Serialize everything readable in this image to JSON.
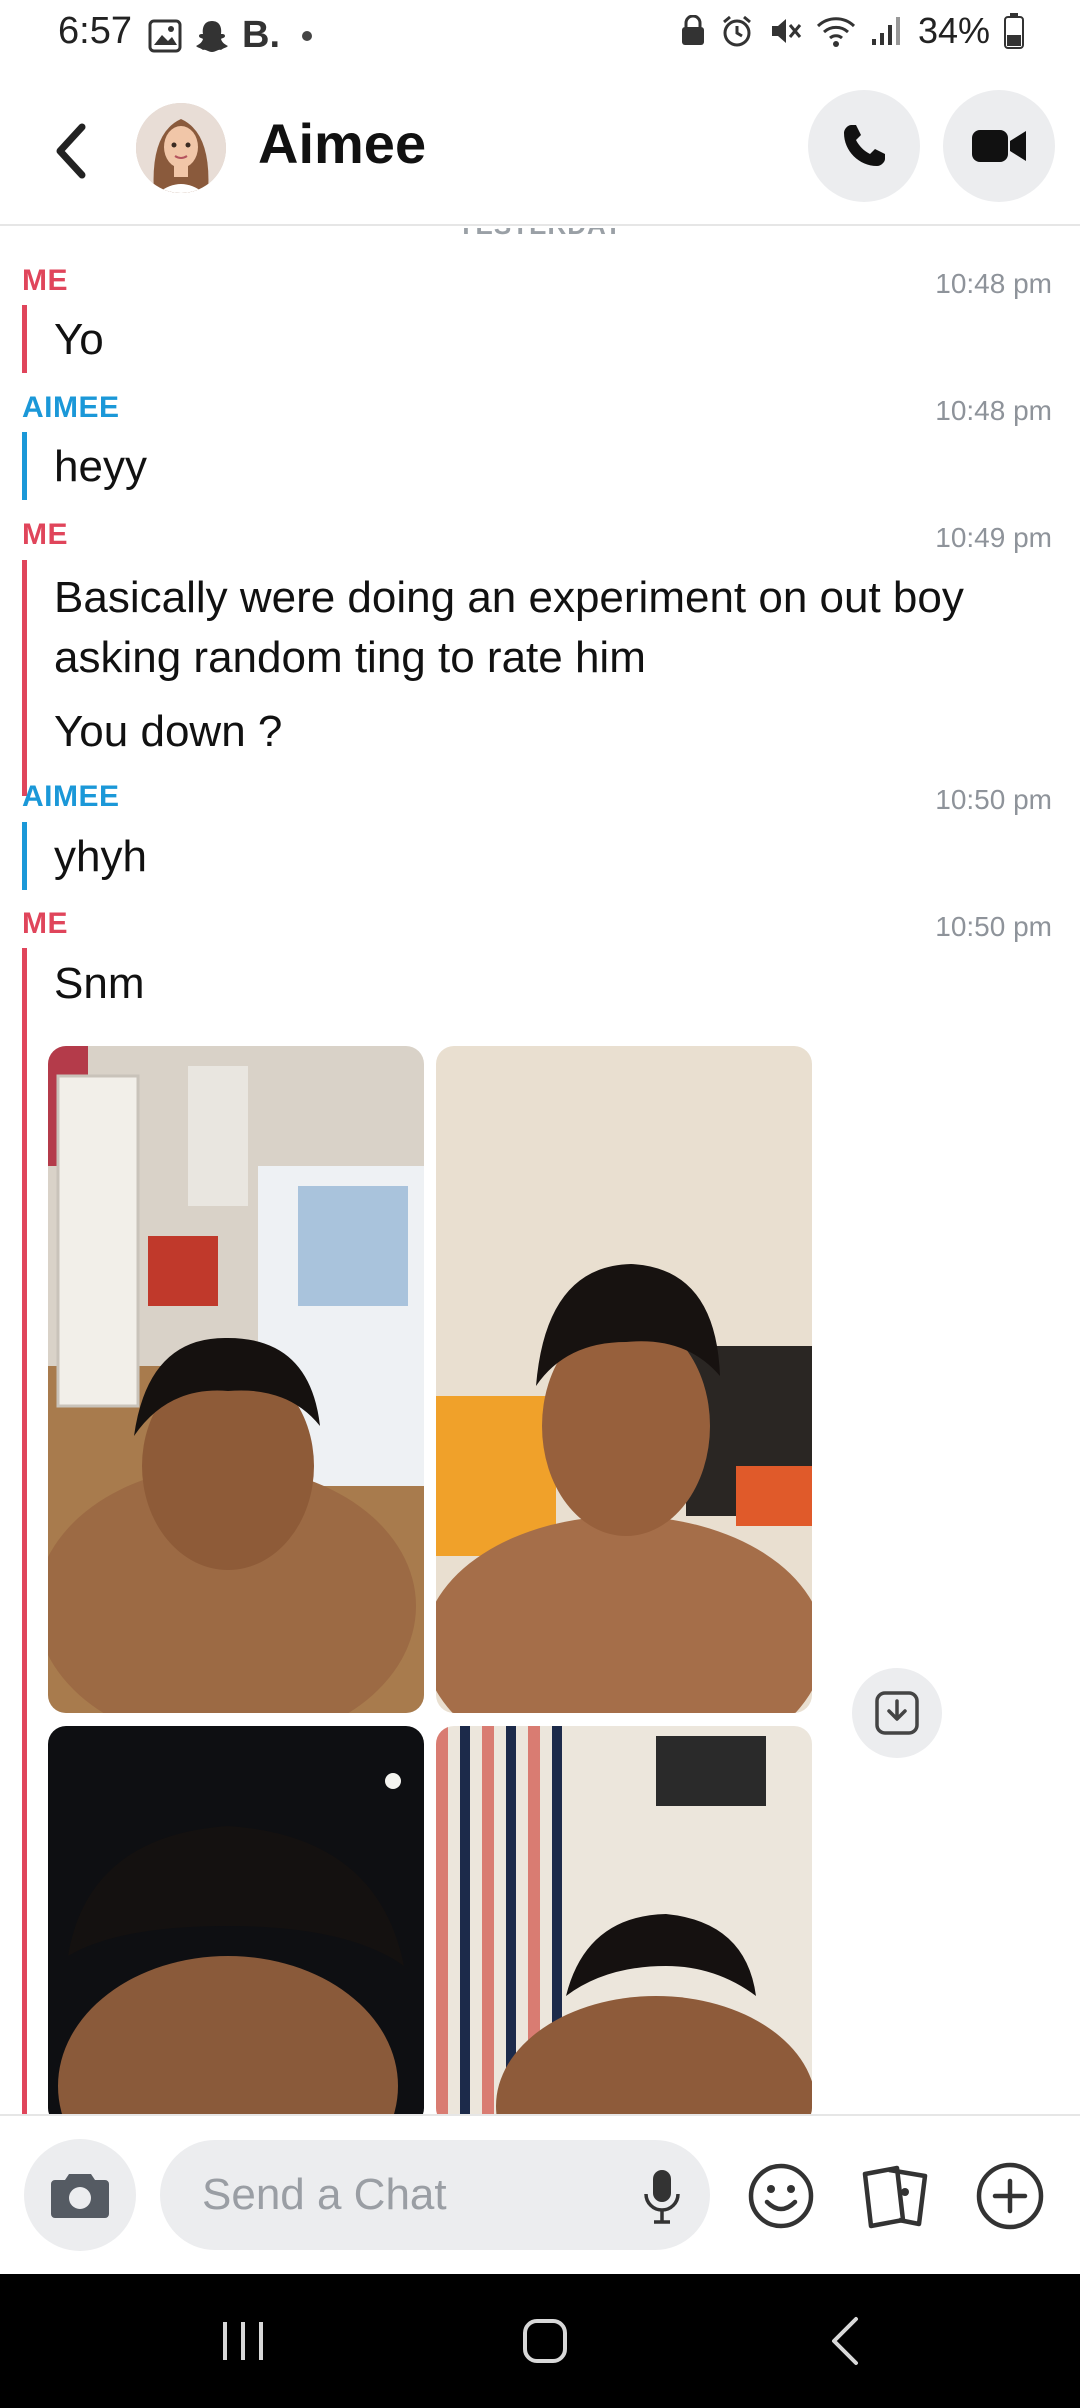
{
  "status_bar": {
    "time": "6:57",
    "notif_b": "B.",
    "battery": "34%"
  },
  "header": {
    "contact_name": "Aimee",
    "back_icon": "chevron-left-icon",
    "call_icon": "phone-icon",
    "video_icon": "video-camera-icon"
  },
  "chat": {
    "day_label": "YESTERDAY",
    "groups": [
      {
        "sender": "ME",
        "time": "10:48 pm",
        "messages": [
          "Yo"
        ]
      },
      {
        "sender": "AIMEE",
        "time": "10:48 pm",
        "messages": [
          "heyy"
        ]
      },
      {
        "sender": "ME",
        "time": "10:49 pm",
        "messages": [
          "Basically were doing an experiment on out boy asking random ting to rate him",
          "You down ?"
        ]
      },
      {
        "sender": "AIMEE",
        "time": "10:50 pm",
        "messages": [
          "yhyh"
        ]
      },
      {
        "sender": "ME",
        "time": "10:50 pm",
        "messages": [
          "Snm"
        ]
      }
    ],
    "photos": [
      "photo-1",
      "photo-2",
      "photo-3",
      "photo-4"
    ]
  },
  "composer": {
    "placeholder": "Send a Chat"
  },
  "colors": {
    "me": "#e0455b",
    "aimee": "#1b98d8",
    "button_bg": "#ecedef"
  }
}
